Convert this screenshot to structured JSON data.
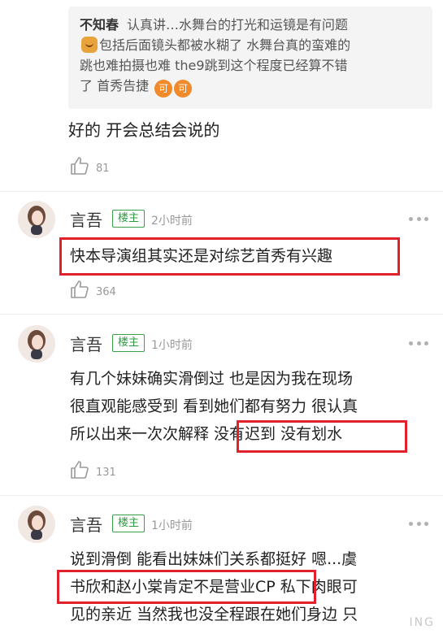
{
  "quote": {
    "author": "不知春",
    "line1": "认真讲…水舞台的打光和运镜是有问题",
    "line2": "包括后面镜头都被水糊了 水舞台真的蛮难的",
    "line3": "跳也难拍摄也难 the9跳到这个程度已经算不错",
    "line4": "了 首秀告捷",
    "badge1": "可",
    "badge2": "可"
  },
  "reply": {
    "text": "好的 开会总结会说的",
    "likes": "81"
  },
  "comments": [
    {
      "username": "言吾",
      "badge": "楼主",
      "time": "2小时前",
      "lines": [
        "快本导演组其实还是对综艺首秀有兴趣"
      ],
      "likes": "364"
    },
    {
      "username": "言吾",
      "badge": "楼主",
      "time": "1小时前",
      "lines": [
        "有几个妹妹确实滑倒过 也是因为我在现场",
        "很直观能感受到 看到她们都有努力 很认真",
        "所以出来一次次解释 没有迟到 没有划水"
      ],
      "likes": "131"
    },
    {
      "username": "言吾",
      "badge": "楼主",
      "time": "1小时前",
      "lines": [
        "说到滑倒 能看出妹妹们关系都挺好 嗯...虞",
        "书欣和赵小棠肯定不是营业CP 私下肉眼可",
        "见的亲近 当然我也没全程跟在她们身边 只"
      ]
    }
  ],
  "watermark": "ING",
  "colors": {
    "highlight": "#e0202a",
    "op_badge": "#2e9b40",
    "meta": "#999999"
  }
}
